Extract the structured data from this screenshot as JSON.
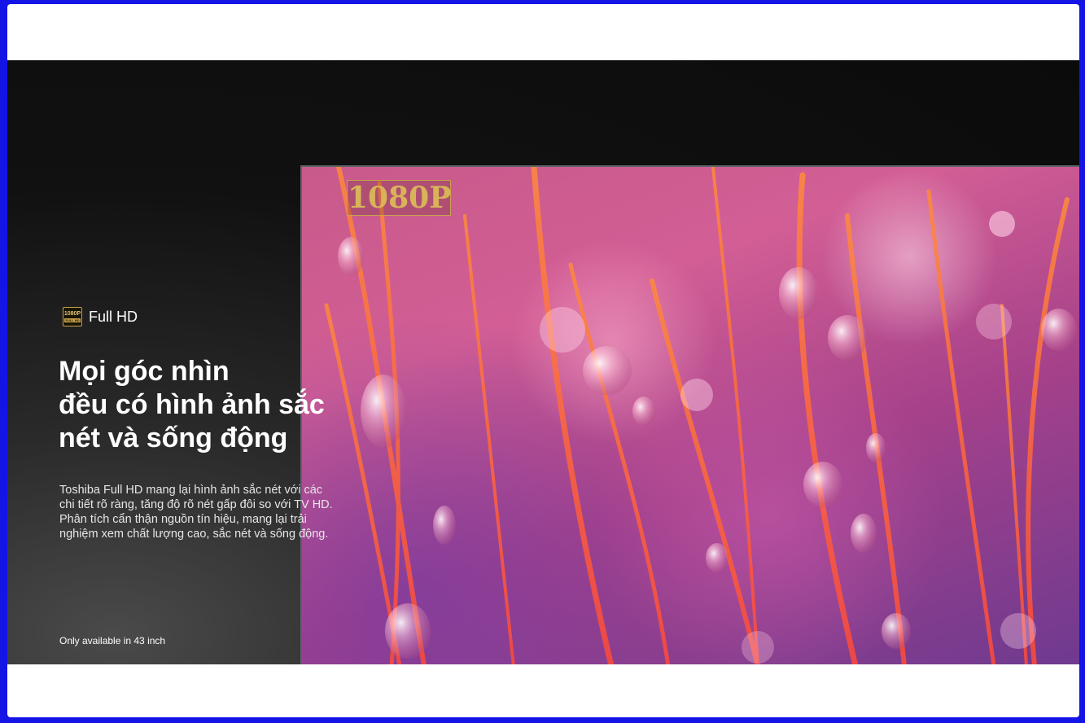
{
  "feature": {
    "logo_text_top": "1080P",
    "logo_text_bottom": "FULL HD",
    "label": "Full HD"
  },
  "headline": "Mọi góc nhìn\nđều có hình ảnh sắc\nnét và sống động",
  "description": "Toshiba Full HD mang lại hình ảnh sắc nét với các chi tiết rõ ràng, tăng độ rõ nét gấp đôi so với TV HD. Phân tích cẩn thận nguồn tín hiệu, mang lại trải nghiệm xem chất lượng cao, sắc nét và sống động.",
  "note": "Only available in 43 inch",
  "tv_image": {
    "badge": "1080P",
    "scene": "water-droplets-on-grass-icon"
  },
  "colors": {
    "page_border": "#1414e6",
    "banner_bg": "#111111",
    "gold": "#c9a24a"
  }
}
